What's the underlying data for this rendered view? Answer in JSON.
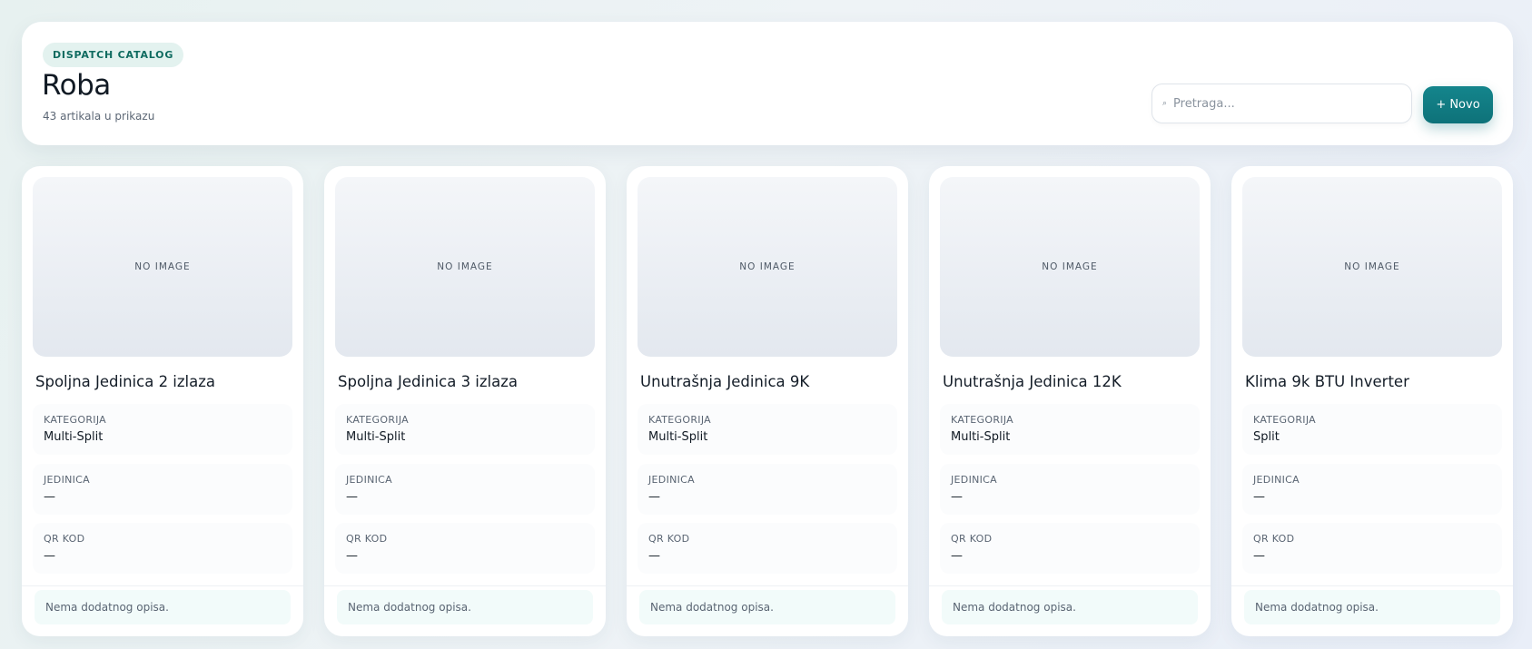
{
  "header": {
    "badge": "DISPATCH CATALOG",
    "title": "Roba",
    "subtitle": "43 artikala u prikazu",
    "search_placeholder": "Pretraga...",
    "search_icon": "search-icon",
    "new_button": "+ Novo"
  },
  "colors": {
    "accent": "#0e7279",
    "badge_bg": "#e3f2ef",
    "badge_text": "#0f6b60",
    "note_bg": "#f2fbfa"
  },
  "cards": [
    {
      "image_placeholder": "NO IMAGE",
      "title": "Spoljna Jedinica 2 izlaza",
      "fields": [
        {
          "label": "KATEGORIJA",
          "value": "Multi-Split"
        },
        {
          "label": "JEDINICA",
          "value": "—"
        },
        {
          "label": "QR KOD",
          "value": "—"
        }
      ],
      "note": "Nema dodatnog opisa."
    },
    {
      "image_placeholder": "NO IMAGE",
      "title": "Spoljna Jedinica 3 izlaza",
      "fields": [
        {
          "label": "KATEGORIJA",
          "value": "Multi-Split"
        },
        {
          "label": "JEDINICA",
          "value": "—"
        },
        {
          "label": "QR KOD",
          "value": "—"
        }
      ],
      "note": "Nema dodatnog opisa."
    },
    {
      "image_placeholder": "NO IMAGE",
      "title": "Unutrašnja Jedinica 9K",
      "fields": [
        {
          "label": "KATEGORIJA",
          "value": "Multi-Split"
        },
        {
          "label": "JEDINICA",
          "value": "—"
        },
        {
          "label": "QR KOD",
          "value": "—"
        }
      ],
      "note": "Nema dodatnog opisa."
    },
    {
      "image_placeholder": "NO IMAGE",
      "title": "Unutrašnja Jedinica 12K",
      "fields": [
        {
          "label": "KATEGORIJA",
          "value": "Multi-Split"
        },
        {
          "label": "JEDINICA",
          "value": "—"
        },
        {
          "label": "QR KOD",
          "value": "—"
        }
      ],
      "note": "Nema dodatnog opisa."
    },
    {
      "image_placeholder": "NO IMAGE",
      "title": "Klima 9k BTU Inverter",
      "fields": [
        {
          "label": "KATEGORIJA",
          "value": "Split"
        },
        {
          "label": "JEDINICA",
          "value": "—"
        },
        {
          "label": "QR KOD",
          "value": "—"
        }
      ],
      "note": "Nema dodatnog opisa."
    }
  ]
}
